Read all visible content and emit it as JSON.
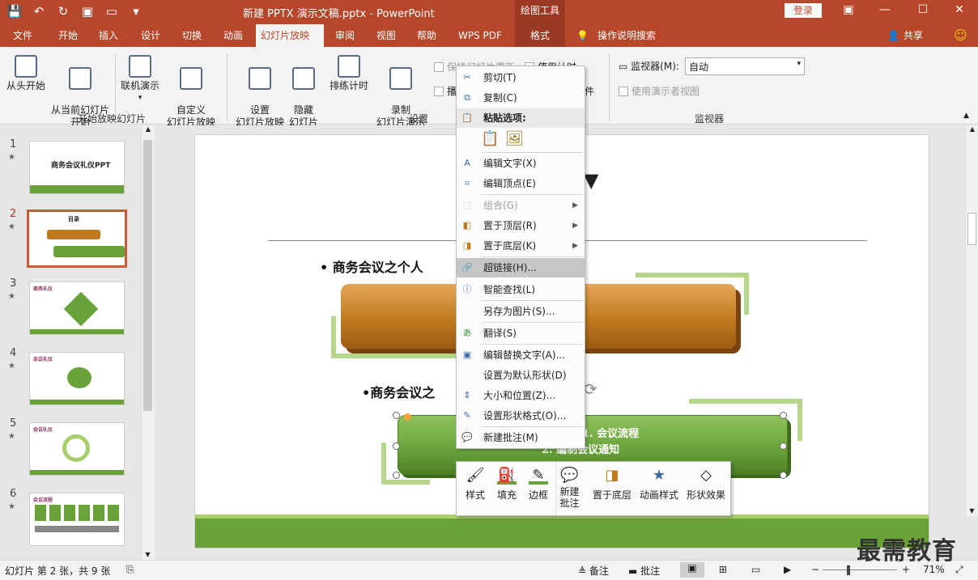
{
  "window": {
    "title": "新建 PPTX 演示文稿.pptx  -  PowerPoint",
    "context_tab_title": "绘图工具",
    "login": "登录"
  },
  "tabs": [
    "文件",
    "开始",
    "插入",
    "设计",
    "切换",
    "动画",
    "幻灯片放映",
    "审阅",
    "视图",
    "帮助",
    "WPS PDF",
    "格式"
  ],
  "tell_me": "操作说明搜索",
  "share": "共享",
  "ribbon": {
    "from_start": "从头开始",
    "from_current": "从当前幻灯片\n开始",
    "online": "联机演示",
    "custom": "自定义\n幻灯片放映",
    "group_start": "开始放映幻灯片",
    "setup": "设置\n幻灯片放映",
    "hide": "隐藏\n幻灯片",
    "rehearse": "排练计时",
    "record": "录制\n幻灯片演示",
    "chk_keep": "保持幻灯片更新",
    "chk_timing": "使用计时",
    "chk_play": "播",
    "chk_media": "件",
    "group_setup": "设置",
    "monitor_label": "监视器(M):",
    "monitor_value": "自动",
    "presenter_view": "使用演示者视图",
    "group_monitor": "监视器"
  },
  "slides": [
    {
      "num": "1",
      "title": "商务会议礼仪PPT"
    },
    {
      "num": "2",
      "title": "目录"
    },
    {
      "num": "3",
      "title": "商务礼仪"
    },
    {
      "num": "4",
      "title": "会议礼仪"
    },
    {
      "num": "5",
      "title": "会议礼仪"
    },
    {
      "num": "6",
      "title": "会议流程"
    }
  ],
  "slide": {
    "bullet1": "• 商务会议之个人",
    "bullet2": "•商务会议之",
    "shape_text": [
      "1. 会议流程",
      "2. 编制会议通知"
    ]
  },
  "context_menu": {
    "cut": "剪切(T)",
    "copy": "复制(C)",
    "paste_options": "粘贴选项:",
    "edit_text": "编辑文字(X)",
    "edit_points": "编辑顶点(E)",
    "group": "组合(G)",
    "bring_front": "置于顶层(R)",
    "send_back": "置于底层(K)",
    "hyperlink": "超链接(H)...",
    "smart_lookup": "智能查找(L)",
    "save_as_picture": "另存为图片(S)...",
    "translate": "翻译(S)",
    "edit_alt_text": "编辑替换文字(A)...",
    "set_default": "设置为默认形状(D)",
    "size_position": "大小和位置(Z)...",
    "format_shape": "设置形状格式(O)...",
    "new_comment": "新建批注(M)"
  },
  "mini_toolbar": {
    "style": "样式",
    "fill": "填充",
    "outline": "边框",
    "new_comment": "新建\n批注",
    "send_back": "置于底层",
    "animation": "动画样式",
    "effects": "形状效果"
  },
  "status": {
    "slide_info": "幻灯片 第 2 张，共 9 张",
    "notes": "备注",
    "comments": "批注",
    "zoom": "71%"
  },
  "watermark": "最需教育",
  "colors": {
    "accent": "#b7472a",
    "green": "#6aa23a",
    "orange": "#c07a1e"
  }
}
